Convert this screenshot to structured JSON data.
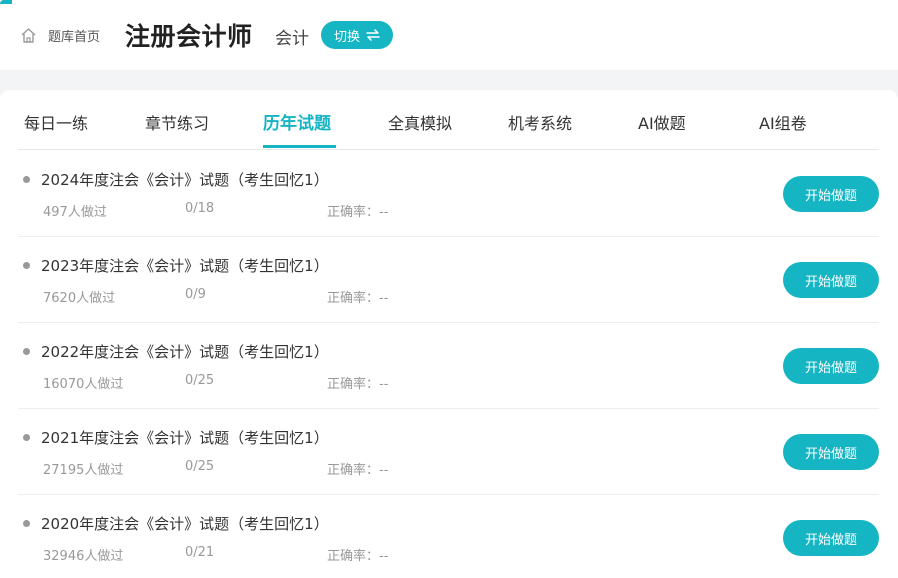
{
  "header": {
    "home_label": "题库首页",
    "title": "注册会计师",
    "subject": "会计",
    "switch_label": "切换",
    "home_icon": "home-icon",
    "switch_icon": "swap-arrows-icon"
  },
  "tabs": [
    {
      "label": "每日一练",
      "active": false
    },
    {
      "label": "章节练习",
      "active": false
    },
    {
      "label": "历年试题",
      "active": true
    },
    {
      "label": "全真模拟",
      "active": false
    },
    {
      "label": "机考系统",
      "active": false
    },
    {
      "label": "AI做题",
      "active": false
    },
    {
      "label": "AI组卷",
      "active": false
    }
  ],
  "exams": [
    {
      "title": "2024年度注会《会计》试题（考生回忆1）",
      "done_count": "497人做过",
      "progress": "0/18",
      "accuracy_label": "正确率：--",
      "button_label": "开始做题"
    },
    {
      "title": "2023年度注会《会计》试题（考生回忆1）",
      "done_count": "7620人做过",
      "progress": "0/9",
      "accuracy_label": "正确率：--",
      "button_label": "开始做题"
    },
    {
      "title": "2022年度注会《会计》试题（考生回忆1）",
      "done_count": "16070人做过",
      "progress": "0/25",
      "accuracy_label": "正确率：--",
      "button_label": "开始做题"
    },
    {
      "title": "2021年度注会《会计》试题（考生回忆1）",
      "done_count": "27195人做过",
      "progress": "0/25",
      "accuracy_label": "正确率：--",
      "button_label": "开始做题"
    },
    {
      "title": "2020年度注会《会计》试题（考生回忆1）",
      "done_count": "32946人做过",
      "progress": "0/21",
      "accuracy_label": "正确率：--",
      "button_label": "开始做题"
    }
  ],
  "colors": {
    "accent": "#16b5c4",
    "background": "#f3f4f6",
    "muted_text": "#999999"
  }
}
